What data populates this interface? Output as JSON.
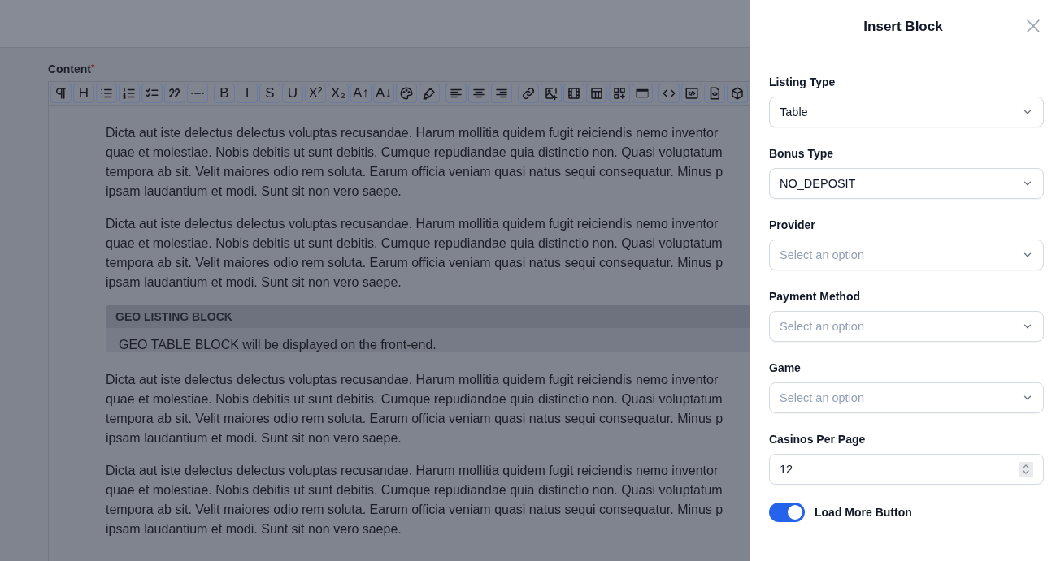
{
  "editor": {
    "label": "Content",
    "required_mark": "*",
    "toolbar": [
      [
        {
          "kind": "icon"
        },
        {
          "kind": "text",
          "label": "H"
        },
        {
          "kind": "icon"
        },
        {
          "kind": "icon"
        },
        {
          "kind": "icon"
        },
        {
          "kind": "icon"
        },
        {
          "kind": "icon"
        }
      ],
      [
        {
          "kind": "text",
          "label": "B"
        },
        {
          "kind": "text",
          "label": "I"
        },
        {
          "kind": "text",
          "label": "S"
        },
        {
          "kind": "text",
          "label": "U"
        },
        {
          "kind": "text",
          "label": "X²"
        },
        {
          "kind": "text",
          "label": "X₂"
        },
        {
          "kind": "text",
          "label": "A↑"
        },
        {
          "kind": "text",
          "label": "A↓"
        },
        {
          "kind": "icon"
        },
        {
          "kind": "icon"
        }
      ],
      [
        {
          "kind": "icon"
        },
        {
          "kind": "icon"
        },
        {
          "kind": "icon"
        }
      ],
      [
        {
          "kind": "icon"
        },
        {
          "kind": "icon"
        },
        {
          "kind": "icon"
        },
        {
          "kind": "icon"
        },
        {
          "kind": "icon"
        },
        {
          "kind": "icon"
        }
      ],
      [
        {
          "kind": "icon"
        },
        {
          "kind": "icon"
        },
        {
          "kind": "icon"
        },
        {
          "kind": "icon"
        }
      ]
    ],
    "blocks": [
      {
        "kind": "paragraph",
        "lines": [
          "Dicta aut iste delectus delectus voluptas recusandae. Harum mollitia quidem fugit reiciendis nemo inventor",
          "quae et molestiae. Nobis debitis ut sunt debitis. Cumque repudiandae quia distinctio non. Quasi voluptatum",
          "tempora ab sit. Velit maiores odio rem soluta. Earum officia veniam quasi natus sequi consequatur. Minus p",
          "ipsam laudantium et modi. Sunt sit non vero saepe."
        ]
      },
      {
        "kind": "paragraph",
        "lines": [
          "Dicta aut iste delectus delectus voluptas recusandae. Harum mollitia quidem fugit reiciendis nemo inventor",
          "quae et molestiae. Nobis debitis ut sunt debitis. Cumque repudiandae quia distinctio non. Quasi voluptatum",
          "tempora ab sit. Velit maiores odio rem soluta. Earum officia veniam quasi natus sequi consequatur. Minus p",
          "ipsam laudantium et modi. Sunt sit non vero saepe."
        ]
      },
      {
        "kind": "embed",
        "title": "GEO LISTING BLOCK",
        "text": "GEO TABLE BLOCK will be displayed on the front-end."
      },
      {
        "kind": "paragraph",
        "lines": [
          "Dicta aut iste delectus delectus voluptas recusandae. Harum mollitia quidem fugit reiciendis nemo inventor",
          "quae et molestiae. Nobis debitis ut sunt debitis. Cumque repudiandae quia distinctio non. Quasi voluptatum",
          "tempora ab sit. Velit maiores odio rem soluta. Earum officia veniam quasi natus sequi consequatur. Minus p",
          "ipsam laudantium et modi. Sunt sit non vero saepe."
        ]
      },
      {
        "kind": "paragraph",
        "lines": [
          "Dicta aut iste delectus delectus voluptas recusandae. Harum mollitia quidem fugit reiciendis nemo inventor",
          "quae et molestiae. Nobis debitis ut sunt debitis. Cumque repudiandae quia distinctio non. Quasi voluptatum",
          "tempora ab sit. Velit maiores odio rem soluta. Earum officia veniam quasi natus sequi consequatur. Minus p",
          "ipsam laudantium et modi. Sunt sit non vero saepe."
        ]
      }
    ]
  },
  "panel": {
    "title": "Insert Block",
    "fields": [
      {
        "kind": "select",
        "label": "Listing Type",
        "value": "Table"
      },
      {
        "kind": "select",
        "label": "Bonus Type",
        "value": "NO_DEPOSIT"
      },
      {
        "kind": "select",
        "label": "Provider",
        "placeholder": "Select an option"
      },
      {
        "kind": "select",
        "label": "Payment Method",
        "placeholder": "Select an option"
      },
      {
        "kind": "select",
        "label": "Game",
        "placeholder": "Select an option"
      },
      {
        "kind": "number",
        "label": "Casinos Per Page",
        "value": "12"
      }
    ],
    "toggle": {
      "label": "Load More Button",
      "on": true
    }
  }
}
